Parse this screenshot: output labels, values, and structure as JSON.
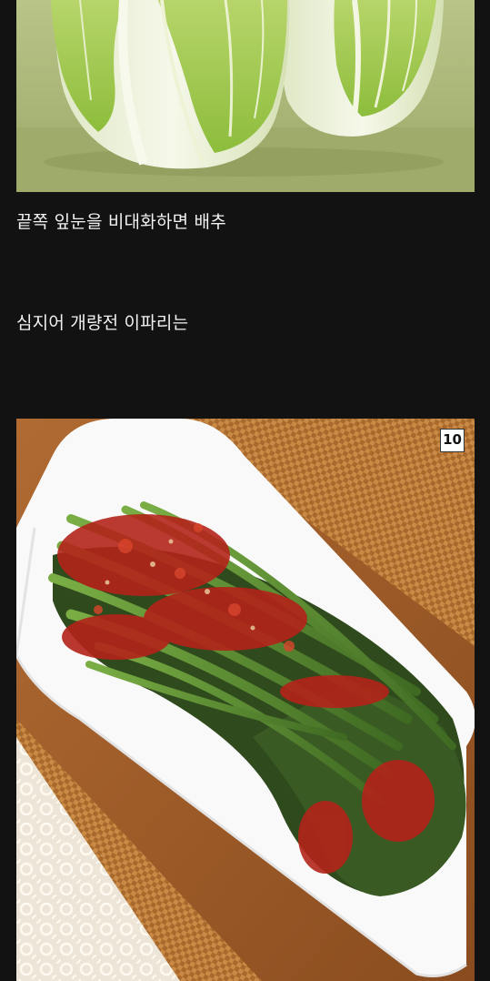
{
  "post": {
    "caption_1": "끝쪽 잎눈을 비대화하면 배추",
    "caption_2": "심지어 개량전 이파리는"
  },
  "image_2": {
    "badge": "10"
  },
  "colors": {
    "background": "#121212",
    "text": "#f2f2f2",
    "cabbage_backdrop": "#a9b576",
    "plate": "#fbfbfb",
    "kimchi_sauce": "#b3231a",
    "stem_green": "#6a9a3a"
  },
  "icons": [
    "napa-cabbage-photo",
    "kimchi-photo"
  ]
}
